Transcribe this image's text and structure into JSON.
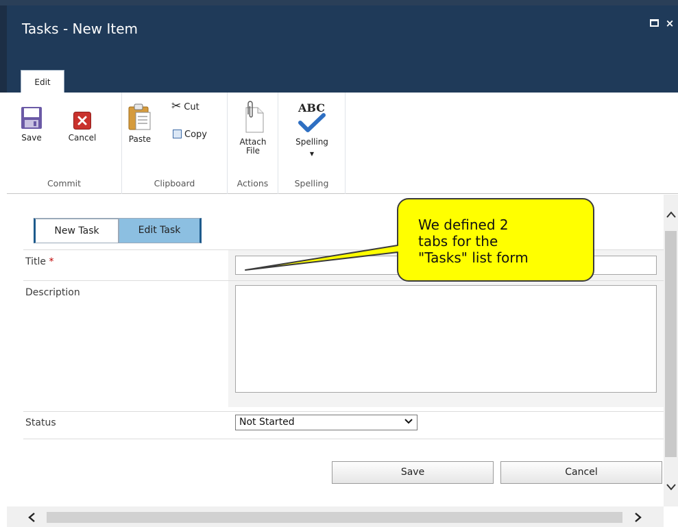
{
  "dialog": {
    "title": "Tasks - New Item",
    "maximize_icon": "maximize-icon",
    "close_icon": "×"
  },
  "ribbon": {
    "tab_label": "Edit",
    "groups": {
      "commit": {
        "label": "Commit",
        "save_label": "Save",
        "cancel_label": "Cancel"
      },
      "clipboard": {
        "label": "Clipboard",
        "paste_label": "Paste",
        "cut_label": "Cut",
        "copy_label": "Copy"
      },
      "actions": {
        "label": "Actions",
        "attach_line1": "Attach",
        "attach_line2": "File"
      },
      "spelling": {
        "label": "Spelling",
        "spelling_label": "Spelling",
        "spelling_icon_text": "ABC"
      }
    }
  },
  "form": {
    "tabs": [
      {
        "label": "New Task"
      },
      {
        "label": "Edit Task"
      }
    ],
    "fields": {
      "title_label": "Title",
      "required_mark": "*",
      "title_value": "",
      "description_label": "Description",
      "description_value": "",
      "status_label": "Status",
      "status_value": "Not Started"
    },
    "save_button": "Save",
    "cancel_button": "Cancel"
  },
  "callout": {
    "line1": "We defined 2",
    "line2": "tabs for the",
    "line3": "\"Tasks\" list form"
  },
  "colors": {
    "titlebar": "#1f3a59",
    "tab_active_border": "#1d5a8c",
    "tab_inactive_bg": "#8cbfe1",
    "callout_fill": "#ffff00",
    "callout_stroke": "#3b3b3b",
    "required": "#bf0000"
  }
}
